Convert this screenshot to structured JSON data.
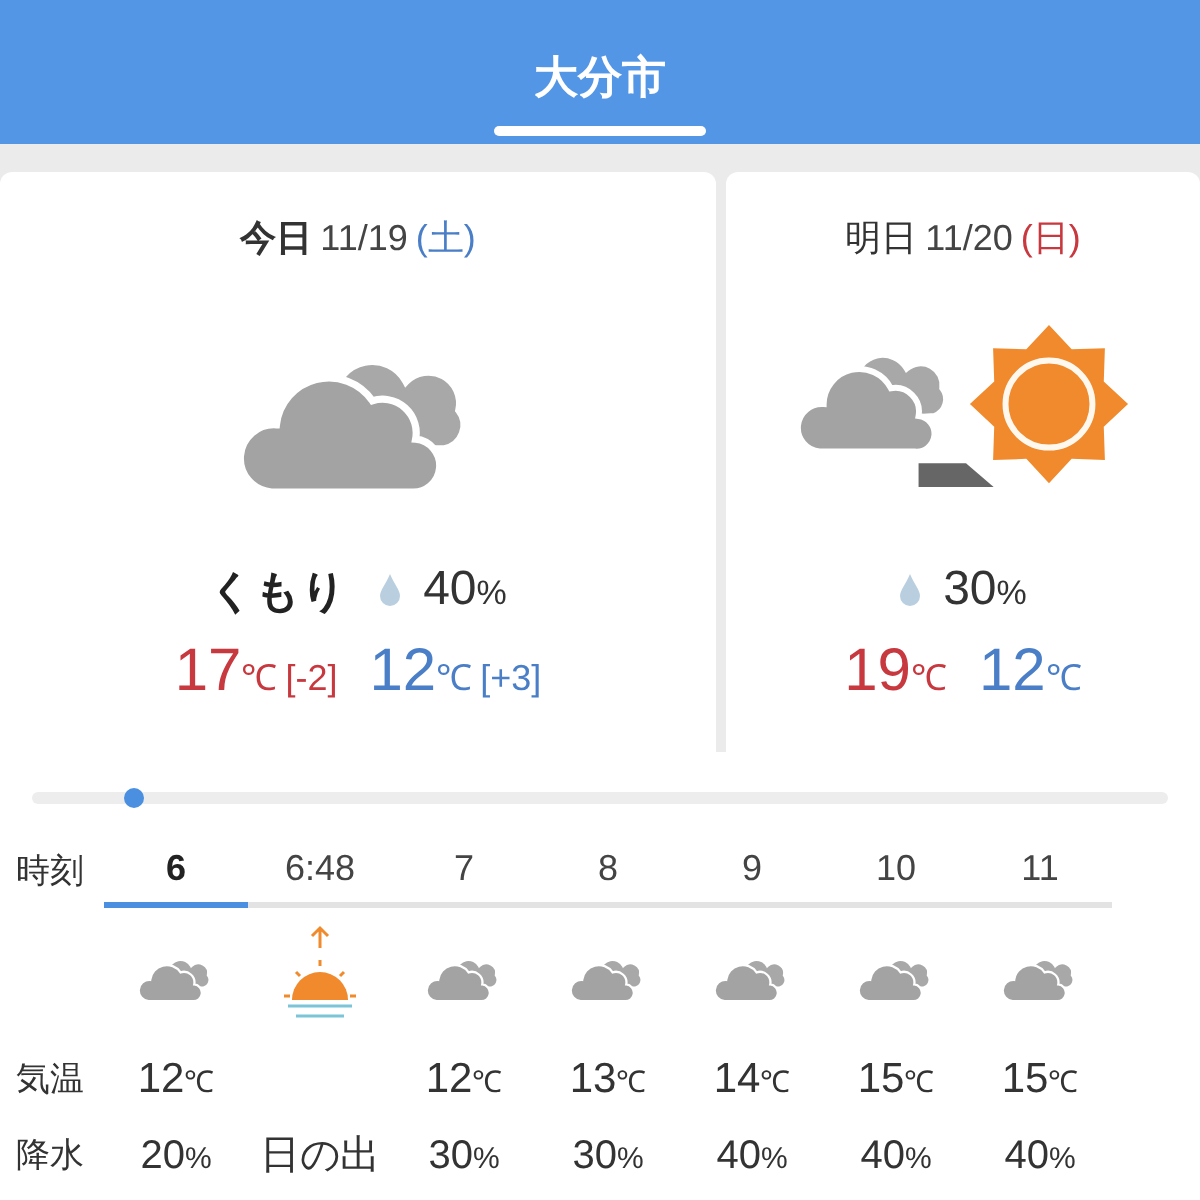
{
  "header": {
    "title": "大分市"
  },
  "days": [
    {
      "label": "今日",
      "date": "11/19",
      "weekday": {
        "text": "(土)",
        "color": "#4a7fc8"
      },
      "kind": "cloudy",
      "condition": "くもり",
      "precip": {
        "value": "40",
        "unit": "%"
      },
      "high": {
        "value": "17",
        "unit": "℃",
        "diff": "[-2]"
      },
      "low": {
        "value": "12",
        "unit": "℃",
        "diff": "[+3]"
      }
    },
    {
      "label": "明日",
      "date": "11/20",
      "weekday": {
        "text": "(日)",
        "color": "#c8383f"
      },
      "kind": "mixed",
      "precip": {
        "value": "30",
        "unit": "%"
      },
      "high": {
        "value": "19",
        "unit": "℃"
      },
      "low": {
        "value": "12",
        "unit": "℃"
      }
    }
  ],
  "timeline": {
    "level": 0.09
  },
  "hourly": {
    "row_labels": [
      "時刻",
      "気温",
      "降水"
    ],
    "columns": [
      {
        "kind": "weather",
        "time": "6",
        "selected": true,
        "temp": "12",
        "unit": "℃",
        "precip": "20",
        "precip_unit": "%"
      },
      {
        "kind": "sunrise",
        "time": "6:48",
        "selected": false,
        "precip": "日の出"
      },
      {
        "kind": "weather",
        "time": "7",
        "selected": false,
        "temp": "12",
        "unit": "℃",
        "precip": "30",
        "precip_unit": "%"
      },
      {
        "kind": "weather",
        "time": "8",
        "selected": false,
        "temp": "13",
        "unit": "℃",
        "precip": "30",
        "precip_unit": "%"
      },
      {
        "kind": "weather",
        "time": "9",
        "selected": false,
        "temp": "14",
        "unit": "℃",
        "precip": "40",
        "precip_unit": "%"
      },
      {
        "kind": "weather",
        "time": "10",
        "selected": false,
        "temp": "15",
        "unit": "℃",
        "precip": "40",
        "precip_unit": "%"
      },
      {
        "kind": "weather",
        "time": "11",
        "selected": false,
        "temp": "15",
        "unit": "℃",
        "precip": "40",
        "precip_unit": "%"
      }
    ]
  }
}
